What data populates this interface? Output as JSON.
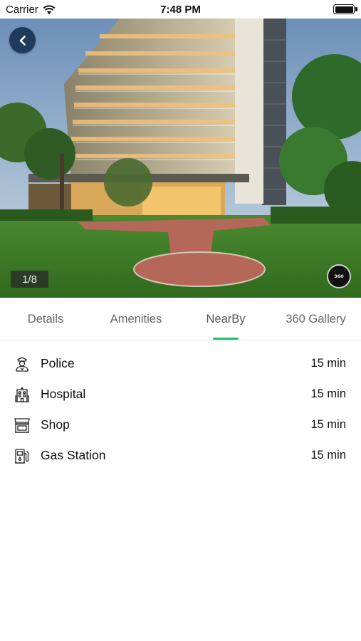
{
  "status_bar": {
    "carrier": "Carrier",
    "time": "7:48 PM",
    "icons": [
      "wifi-icon",
      "battery-icon"
    ]
  },
  "gallery": {
    "counter": "1/8",
    "pano_badge": "360",
    "icons": {
      "back": "chevron-left-icon",
      "pano": "panorama-360-icon"
    }
  },
  "tabs": [
    {
      "label": "Details",
      "active": false
    },
    {
      "label": "Amenities",
      "active": false
    },
    {
      "label": "NearBy",
      "active": true
    },
    {
      "label": "360 Gallery",
      "active": false
    }
  ],
  "nearby": [
    {
      "label": "Police",
      "value": "15 min",
      "icon": "police-icon"
    },
    {
      "label": "Hospital",
      "value": "15 min",
      "icon": "hospital-icon"
    },
    {
      "label": "Shop",
      "value": "15 min",
      "icon": "shop-icon"
    },
    {
      "label": "Gas Station",
      "value": "15 min",
      "icon": "gas-station-icon"
    }
  ],
  "colors": {
    "accent": "#1ec36a",
    "back_button": "#1f3a5a",
    "tab_text": "#666666",
    "text": "#111111"
  }
}
